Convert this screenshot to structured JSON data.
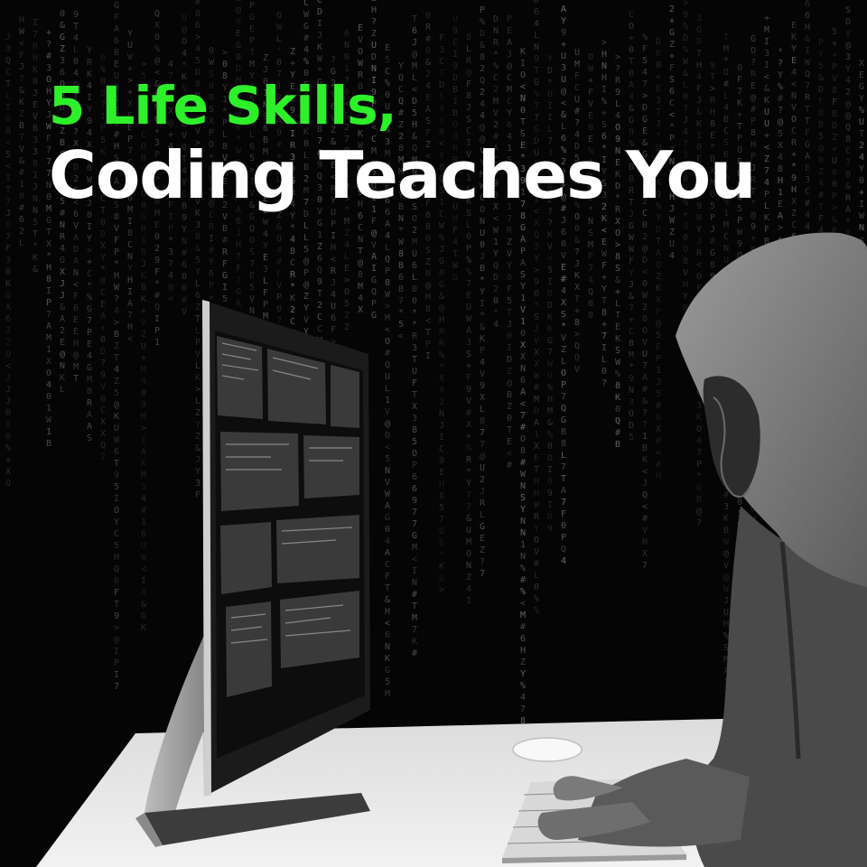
{
  "headline": {
    "line1": "5 Life Skills,",
    "line2": "Coding Teaches You"
  },
  "colors": {
    "background": "#050505",
    "headline_accent": "#2ef02a",
    "headline_main": "#ffffff",
    "matrix_glyphs": "#8a8a8a",
    "desk": "#e8e8e8",
    "hoodie": "#8c8c8c"
  },
  "scene": {
    "background": "matrix-code-rain",
    "objects": [
      "computer-monitor",
      "desk",
      "keyboard",
      "mouse",
      "hooded-person"
    ]
  }
}
